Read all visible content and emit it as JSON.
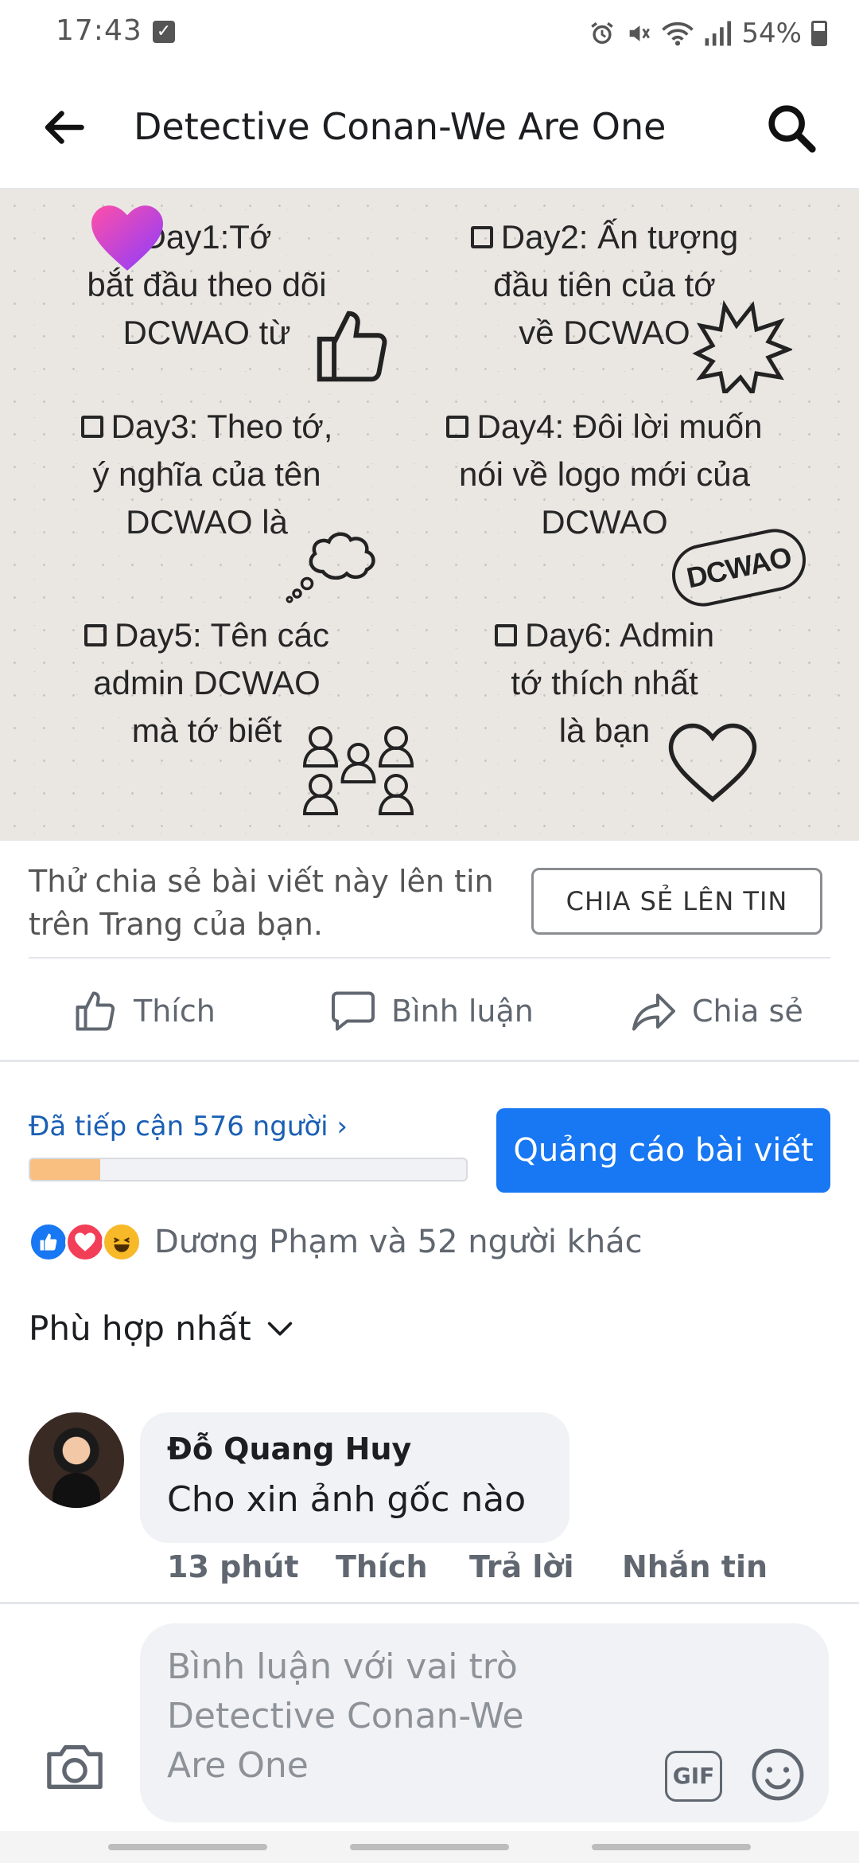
{
  "status_bar": {
    "time": "17:43",
    "battery": "54%"
  },
  "header": {
    "title": "Detective Conan-We Are One"
  },
  "post_image": {
    "days": [
      {
        "text": "Day1:Tớ\nbắt đầu theo dõi\nDCWAO từ"
      },
      {
        "text": "Day2: Ấn tượng\nđầu tiên của tớ\nvề DCWAO"
      },
      {
        "text": "Day3: Theo tớ,\ný nghĩa của tên\nDCWAO là"
      },
      {
        "text": "Day4: Đôi lời muốn\nnói về logo mới của\nDCWAO"
      },
      {
        "text": "Day5: Tên các\nadmin DCWAO\nmà tớ biết"
      },
      {
        "text": "Day6: Admin\ntớ thích nhất\nlà bạn"
      }
    ],
    "logo_text": "DCWAO"
  },
  "share": {
    "prompt": "Thử chia sẻ bài viết này lên tin trên Trang của bạn.",
    "button": "CHIA SẺ LÊN TIN"
  },
  "actions": {
    "like": "Thích",
    "comment": "Bình luận",
    "share": "Chia sẻ"
  },
  "reach": {
    "label": "Đã tiếp cận 576 người",
    "progress": 0.16,
    "boost_button": "Quảng cáo bài viết"
  },
  "reactions": {
    "summary": "Dương Phạm và 52 người khác"
  },
  "sort": {
    "label": "Phù hợp nhất"
  },
  "comment": {
    "author": "Đỗ Quang Huy",
    "text": "Cho xin ảnh gốc nào",
    "time": "13 phút",
    "like": "Thích",
    "reply": "Trả lời",
    "message": "Nhắn tin"
  },
  "composer": {
    "placeholder": "Bình luận với vai trò\nDetective Conan-We\nAre One",
    "gif": "GIF"
  },
  "colors": {
    "accent": "#1877f2",
    "link": "#1a5fb4",
    "progress": "#f9bf80"
  }
}
